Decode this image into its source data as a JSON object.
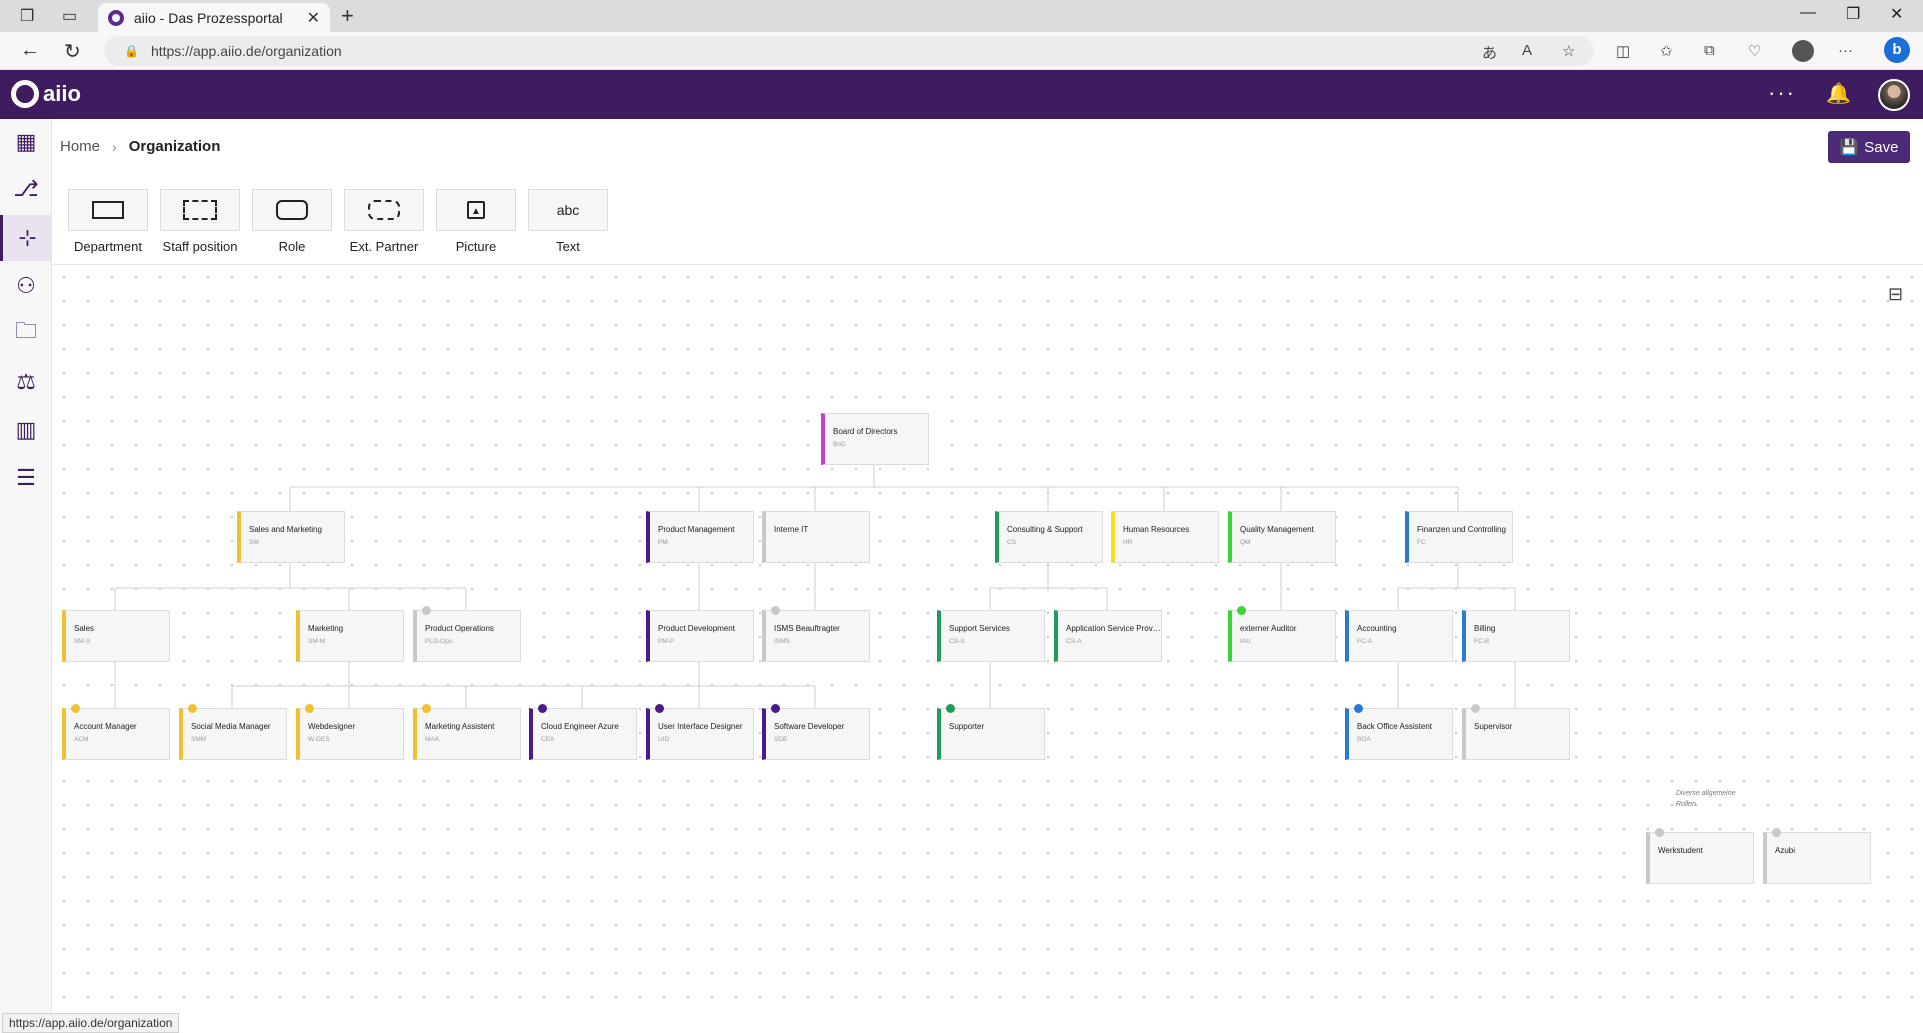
{
  "browser": {
    "tab_title": "aiio - Das Prozessportal",
    "url": "https://app.aiio.de/organization",
    "status_url": "https://app.aiio.de/organization"
  },
  "app": {
    "logo_text": "aiio",
    "brand_color": "#3e1c5f"
  },
  "breadcrumb": {
    "home": "Home",
    "current": "Organization"
  },
  "toolbar": {
    "save_label": "Save"
  },
  "palette": [
    {
      "label": "Department",
      "icon": "rectangle-icon"
    },
    {
      "label": "Staff position",
      "icon": "dashed-rectangle-icon"
    },
    {
      "label": "Role",
      "icon": "rounded-rectangle-icon"
    },
    {
      "label": "Ext. Partner",
      "icon": "dashed-rounded-rectangle-icon"
    },
    {
      "label": "Picture",
      "icon": "picture-icon"
    },
    {
      "label": "Text",
      "icon": "text-icon",
      "glyph": "abc"
    }
  ],
  "canvas_note": {
    "line1": "Diverse allgemeine",
    "line2": "Rollen"
  },
  "org_nodes": [
    {
      "id": "bod",
      "name": "Board of Directors",
      "abbr": "BoD",
      "color": "#c23fd4"
    },
    {
      "id": "sam",
      "name": "Sales and Marketing",
      "abbr": "SM",
      "color": "#f0c030"
    },
    {
      "id": "pm",
      "name": "Product Management",
      "abbr": "PM",
      "color": "#4a1a8c"
    },
    {
      "id": "iit",
      "name": "Interne IT",
      "abbr": "",
      "color": "#c8c8c8"
    },
    {
      "id": "cs",
      "name": "Consulting & Support",
      "abbr": "CS",
      "color": "#1e9e5a"
    },
    {
      "id": "hr",
      "name": "Human Resources",
      "abbr": "HR",
      "color": "#f5e020"
    },
    {
      "id": "qm",
      "name": "Quality Management",
      "abbr": "QM",
      "color": "#3ad43a"
    },
    {
      "id": "fc",
      "name": "Finanzen und Controlling",
      "abbr": "FC",
      "color": "#2a7ad4"
    },
    {
      "id": "sales",
      "name": "Sales",
      "abbr": "SM-S",
      "color": "#f0c030"
    },
    {
      "id": "mkt",
      "name": "Marketing",
      "abbr": "SM-M",
      "color": "#f0c030"
    },
    {
      "id": "plg",
      "name": "Product Operations",
      "abbr": "PLG-Ops",
      "color": "#c8c8c8",
      "icon": true
    },
    {
      "id": "pd",
      "name": "Product Development",
      "abbr": "PM-P",
      "color": "#4a1a8c"
    },
    {
      "id": "isms",
      "name": "ISMS Beauftragter",
      "abbr": "ISMS",
      "color": "#c8c8c8",
      "icon": true
    },
    {
      "id": "ss",
      "name": "Support Services",
      "abbr": "CS-S",
      "color": "#1e9e5a"
    },
    {
      "id": "asp",
      "name": "Application Service Provi...",
      "abbr": "CS-A",
      "color": "#1e9e5a"
    },
    {
      "id": "iau",
      "name": "externer Auditor",
      "abbr": "IAU",
      "color": "#3ad43a",
      "icon": true
    },
    {
      "id": "acc",
      "name": "Accounting",
      "abbr": "FC-A",
      "color": "#2a7ad4"
    },
    {
      "id": "bill",
      "name": "Billing",
      "abbr": "FC-B",
      "color": "#2a7ad4"
    },
    {
      "id": "acm",
      "name": "Account Manager",
      "abbr": "ACM",
      "color": "#f0c030",
      "icon": true
    },
    {
      "id": "smm",
      "name": "Social Media Manager",
      "abbr": "SMM",
      "color": "#f0c030",
      "icon": true
    },
    {
      "id": "wdes",
      "name": "Webdesigner",
      "abbr": "W-DES",
      "color": "#f0c030",
      "icon": true
    },
    {
      "id": "maa",
      "name": "Marketing Assistent",
      "abbr": "MAA",
      "color": "#f0c030",
      "icon": true
    },
    {
      "id": "cea",
      "name": "Cloud Engineer Azure",
      "abbr": "CEA",
      "color": "#4a1a8c",
      "icon": true
    },
    {
      "id": "uid",
      "name": "User Interface Designer",
      "abbr": "UID",
      "color": "#4a1a8c",
      "icon": true
    },
    {
      "id": "sde",
      "name": "Software Developer",
      "abbr": "SDE",
      "color": "#4a1a8c",
      "icon": true
    },
    {
      "id": "sup",
      "name": "Supporter",
      "abbr": "",
      "color": "#1e9e5a",
      "icon": true
    },
    {
      "id": "boa",
      "name": "Back Office Assistent",
      "abbr": "BOA",
      "color": "#2a7ad4",
      "icon": true
    },
    {
      "id": "svr",
      "name": "Supervisor",
      "abbr": "",
      "color": "#c8c8c8",
      "icon": true
    },
    {
      "id": "ws",
      "name": "Werkstudent",
      "abbr": "",
      "color": "#c8c8c8",
      "icon": true
    },
    {
      "id": "az",
      "name": "Azubi",
      "abbr": "",
      "color": "#c8c8c8",
      "icon": true
    }
  ]
}
